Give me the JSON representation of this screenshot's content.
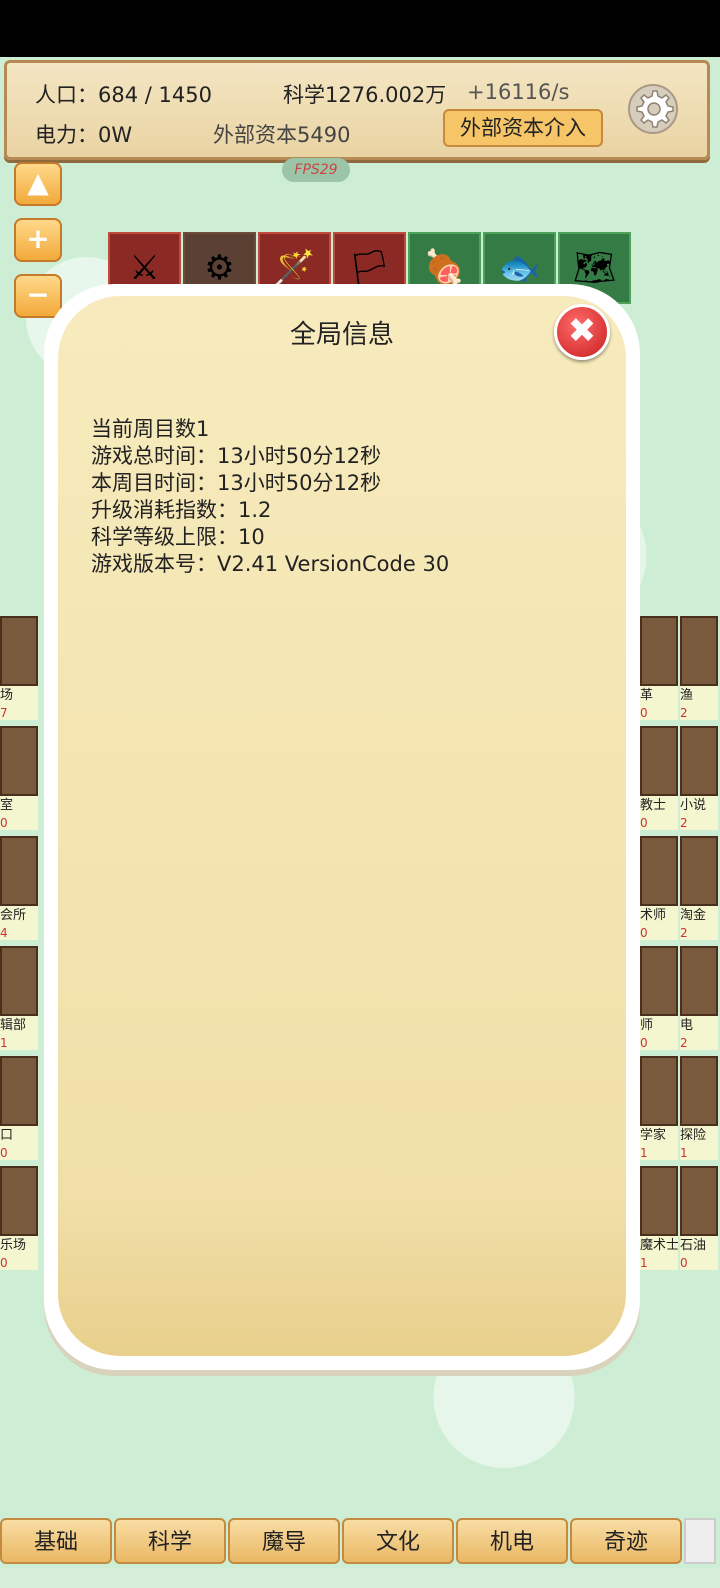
{
  "hud": {
    "population_label": "人口：",
    "population_value": "684 / 1450",
    "science": "科学1276.002万",
    "science_rate": "+16116/s",
    "power": "电力：0W",
    "external_capital": "外部资本5490",
    "external_button": "外部资本介入"
  },
  "fps": "FPS29",
  "side_buttons": {
    "up": "▲",
    "plus": "+",
    "minus": "−"
  },
  "category_tabs": [
    "⚔",
    "⚙",
    "🪄",
    "🏳",
    "🍖",
    "🐟",
    "🗺"
  ],
  "left_cards": [
    {
      "name": "场",
      "num": "7"
    },
    {
      "name": "室",
      "num": "0"
    },
    {
      "name": "会所",
      "num": "4"
    },
    {
      "name": "辑部",
      "num": "1"
    },
    {
      "name": "口",
      "num": "0"
    },
    {
      "name": "乐场",
      "num": "0"
    }
  ],
  "right_cards": [
    {
      "name": "革",
      "num": "0"
    },
    {
      "name": "渔",
      "num": "2"
    },
    {
      "name": "教士",
      "num": "0"
    },
    {
      "name": "小说",
      "num": "2"
    },
    {
      "name": "术师",
      "num": "0"
    },
    {
      "name": "淘金",
      "num": "2"
    },
    {
      "name": "师",
      "num": "0"
    },
    {
      "name": "电",
      "num": "2"
    },
    {
      "name": "学家",
      "num": "1"
    },
    {
      "name": "探险",
      "num": "1"
    },
    {
      "name": "魔术士",
      "num": "1"
    },
    {
      "name": "石油",
      "num": "0"
    }
  ],
  "dialog": {
    "title": "全局信息",
    "close": "✖",
    "lines": [
      "当前周目数1",
      "游戏总时间：13小时50分12秒",
      "本周目时间：13小时50分12秒",
      "升级消耗指数：1.2",
      "科学等级上限：10",
      "游戏版本号：V2.41 VersionCode 30"
    ]
  },
  "bottom_tabs": [
    "基础",
    "科学",
    "魔导",
    "文化",
    "机电",
    "奇迹"
  ]
}
